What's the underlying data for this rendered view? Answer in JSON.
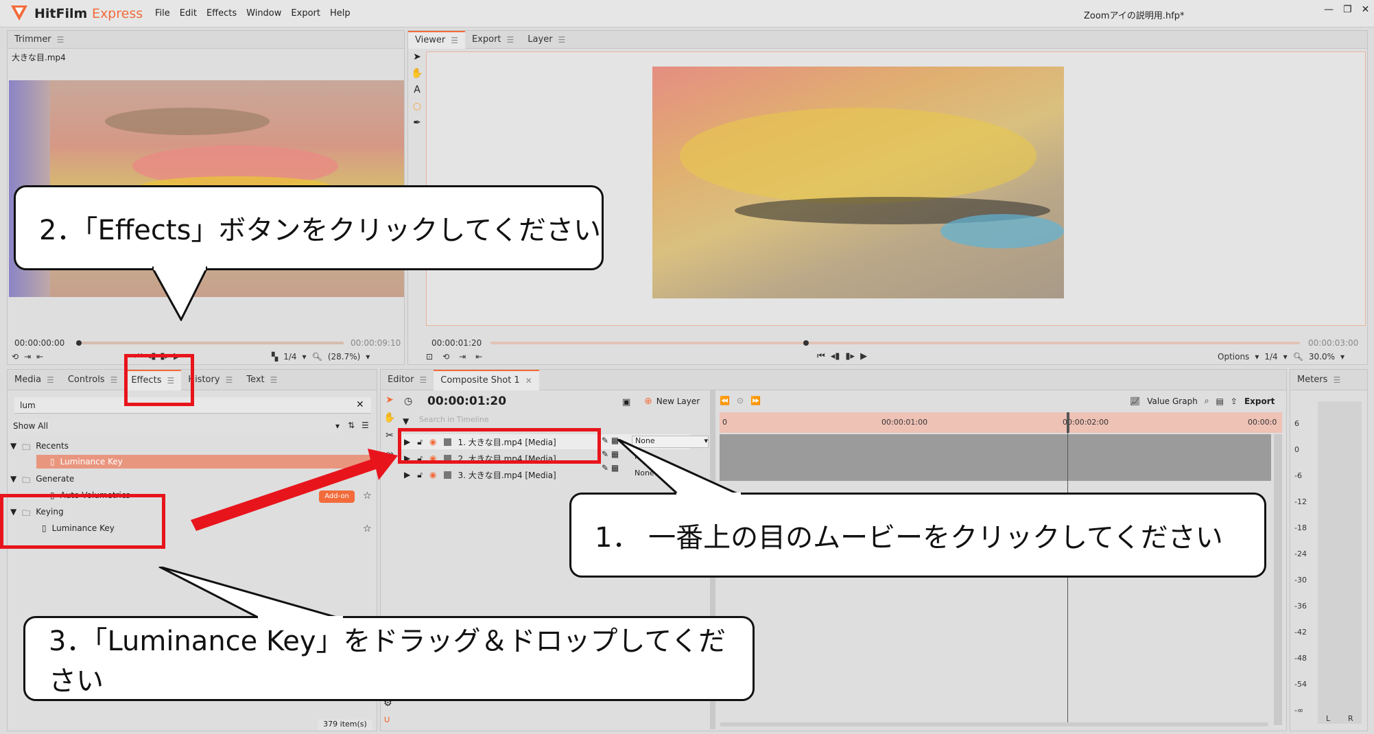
{
  "app": {
    "name": "HitFilm",
    "edition": "Express",
    "doc_title": "Zoomアイの説明用.hfp*"
  },
  "menu": [
    "File",
    "Edit",
    "Effects",
    "Window",
    "Export",
    "Help"
  ],
  "trimmer": {
    "tab": "Trimmer",
    "file": "大きな目.mp4",
    "time_start": "00:00:00:00",
    "time_end": "00:00:09:10",
    "quality": "1/4",
    "zoom": "(28.7%)"
  },
  "viewer": {
    "tabs": [
      "Viewer",
      "Export",
      "Layer"
    ],
    "time_start": "00:00:01:20",
    "time_end": "00:00:03:00",
    "options": "Options",
    "quality": "1/4",
    "zoom": "30.0%",
    "progress": 0.39
  },
  "left_panel": {
    "tabs": [
      "Media",
      "Controls",
      "Effects",
      "History",
      "Text"
    ],
    "search_value": "lum",
    "filter": "Show All",
    "tree": [
      {
        "label": "Recents",
        "children": [
          {
            "label": "Luminance Key",
            "selected": true
          }
        ]
      },
      {
        "label": "Generate",
        "children": [
          {
            "label": "Auto Volumetrics",
            "badge": "Add-on"
          }
        ]
      },
      {
        "label": "Keying",
        "children": [
          {
            "label": "Luminance Key"
          }
        ]
      }
    ],
    "count": "379 item(s)"
  },
  "editor": {
    "tabs": [
      "Editor",
      "Composite Shot 1"
    ],
    "time": "00:00:01:20",
    "new_layer": "New Layer",
    "value_graph": "Value Graph",
    "export": "Export",
    "search_placeholder": "Search in Timeline",
    "layers": [
      {
        "name": "1. 大きな目.mp4 [Media]",
        "blend": "None"
      },
      {
        "name": "2. 大きな目.mp4 [Media]",
        "blend": "None"
      },
      {
        "name": "3. 大きな目.mp4 [Media]",
        "blend": "None"
      }
    ],
    "ruler": [
      "0",
      "00:00:01:00",
      "00:00:02:00",
      "00:00:0"
    ]
  },
  "meters": {
    "tab": "Meters",
    "scale": [
      "6",
      "0",
      "-6",
      "-12",
      "-18",
      "-24",
      "-30",
      "-36",
      "-42",
      "-48",
      "-54",
      "-∞"
    ],
    "channels": [
      "L",
      "R"
    ]
  },
  "callouts": {
    "step1": "1． 一番上の目のムービーをクリックしてください",
    "step2": "2．「Effects」ボタンをクリックしてください",
    "step3": "3．「Luminance Key」をドラッグ＆ドロップしてください"
  },
  "colors": {
    "accent": "#f26b3a",
    "annotation": "#e8141c"
  }
}
